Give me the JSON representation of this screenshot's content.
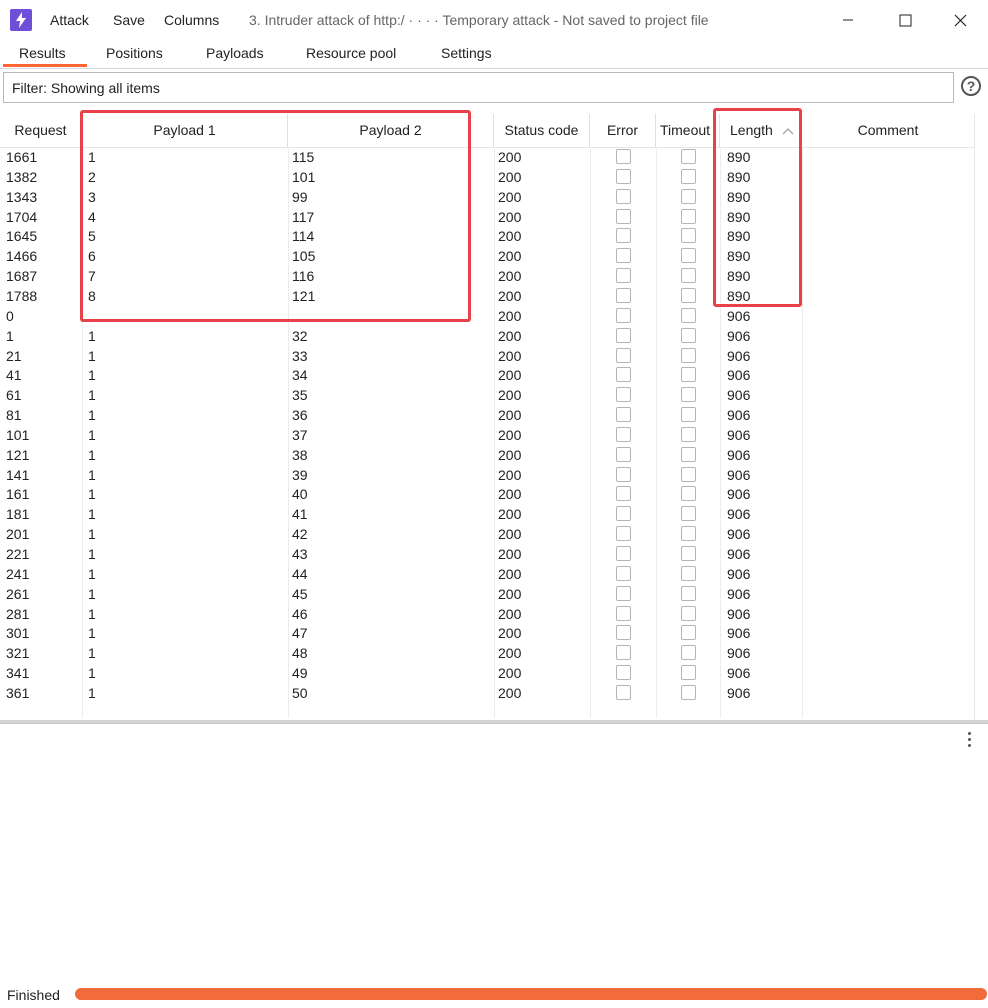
{
  "menu": {
    "attack": "Attack",
    "save": "Save",
    "columns": "Columns"
  },
  "window_title": "3. Intruder attack of http:/  ·  ·  ·  ·  Temporary attack - Not saved to project file",
  "tabs": [
    "Results",
    "Positions",
    "Payloads",
    "Resource pool",
    "Settings"
  ],
  "filter_text": "Filter: Showing all items",
  "columns": [
    "Request",
    "Payload 1",
    "Payload 2",
    "Status code",
    "Error",
    "Timeout",
    "Length",
    "Comment"
  ],
  "rows": [
    [
      "1661",
      "1",
      "115",
      "200",
      "890"
    ],
    [
      "1382",
      "2",
      "101",
      "200",
      "890"
    ],
    [
      "1343",
      "3",
      "99",
      "200",
      "890"
    ],
    [
      "1704",
      "4",
      "117",
      "200",
      "890"
    ],
    [
      "1645",
      "5",
      "114",
      "200",
      "890"
    ],
    [
      "1466",
      "6",
      "105",
      "200",
      "890"
    ],
    [
      "1687",
      "7",
      "116",
      "200",
      "890"
    ],
    [
      "1788",
      "8",
      "121",
      "200",
      "890"
    ],
    [
      "0",
      "",
      "",
      "200",
      "906"
    ],
    [
      "1",
      "1",
      "32",
      "200",
      "906"
    ],
    [
      "21",
      "1",
      "33",
      "200",
      "906"
    ],
    [
      "41",
      "1",
      "34",
      "200",
      "906"
    ],
    [
      "61",
      "1",
      "35",
      "200",
      "906"
    ],
    [
      "81",
      "1",
      "36",
      "200",
      "906"
    ],
    [
      "101",
      "1",
      "37",
      "200",
      "906"
    ],
    [
      "121",
      "1",
      "38",
      "200",
      "906"
    ],
    [
      "141",
      "1",
      "39",
      "200",
      "906"
    ],
    [
      "161",
      "1",
      "40",
      "200",
      "906"
    ],
    [
      "181",
      "1",
      "41",
      "200",
      "906"
    ],
    [
      "201",
      "1",
      "42",
      "200",
      "906"
    ],
    [
      "221",
      "1",
      "43",
      "200",
      "906"
    ],
    [
      "241",
      "1",
      "44",
      "200",
      "906"
    ],
    [
      "261",
      "1",
      "45",
      "200",
      "906"
    ],
    [
      "281",
      "1",
      "46",
      "200",
      "906"
    ],
    [
      "301",
      "1",
      "47",
      "200",
      "906"
    ],
    [
      "321",
      "1",
      "48",
      "200",
      "906"
    ],
    [
      "341",
      "1",
      "49",
      "200",
      "906"
    ],
    [
      "361",
      "1",
      "50",
      "200",
      "906"
    ]
  ],
  "status_text": "Finished",
  "progress": 1.0,
  "colors": {
    "accent": "#ff6633",
    "highlight_box": "#e8414a",
    "progress": "#f26b3a",
    "app_icon": "#6e4fd8"
  },
  "icons": [
    "burp-app-icon",
    "minimize-icon",
    "maximize-icon",
    "close-icon",
    "help-icon",
    "sort-ascending-icon",
    "kebab-menu-icon"
  ]
}
